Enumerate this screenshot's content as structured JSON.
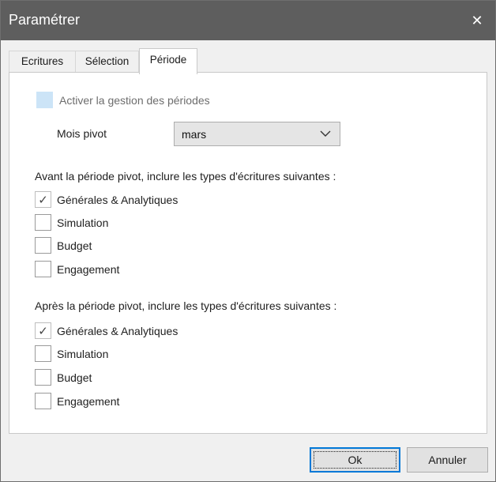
{
  "window": {
    "title": "Paramétrer",
    "close_glyph": "✕"
  },
  "tabs": [
    {
      "label": "Ecritures",
      "active": false
    },
    {
      "label": "Sélection",
      "active": false
    },
    {
      "label": "Période",
      "active": true
    }
  ],
  "periode": {
    "activer_label": "Activer la gestion des périodes",
    "activer_checked": false,
    "mois_pivot_label": "Mois pivot",
    "mois_pivot_value": "mars",
    "avant_heading": "Avant la période pivot, inclure les types d'écritures suivantes :",
    "avant_items": [
      {
        "label": "Générales & Analytiques",
        "checked": true
      },
      {
        "label": "Simulation",
        "checked": false
      },
      {
        "label": "Budget",
        "checked": false
      },
      {
        "label": "Engagement",
        "checked": false
      }
    ],
    "apres_heading": "Après la période pivot, inclure les types d'écritures suivantes :",
    "apres_items": [
      {
        "label": "Générales & Analytiques",
        "checked": true
      },
      {
        "label": "Simulation",
        "checked": false
      },
      {
        "label": "Budget",
        "checked": false
      },
      {
        "label": "Engagement",
        "checked": false
      }
    ]
  },
  "buttons": {
    "ok_label": "Ok",
    "cancel_label": "Annuler"
  },
  "colors": {
    "titlebar": "#5e5e5e",
    "focus_border": "#0078d7",
    "disabled_check": "#cce4f7"
  },
  "icons": {
    "check": "check-icon",
    "close": "close-icon",
    "dropdown": "chevron-down-icon"
  }
}
